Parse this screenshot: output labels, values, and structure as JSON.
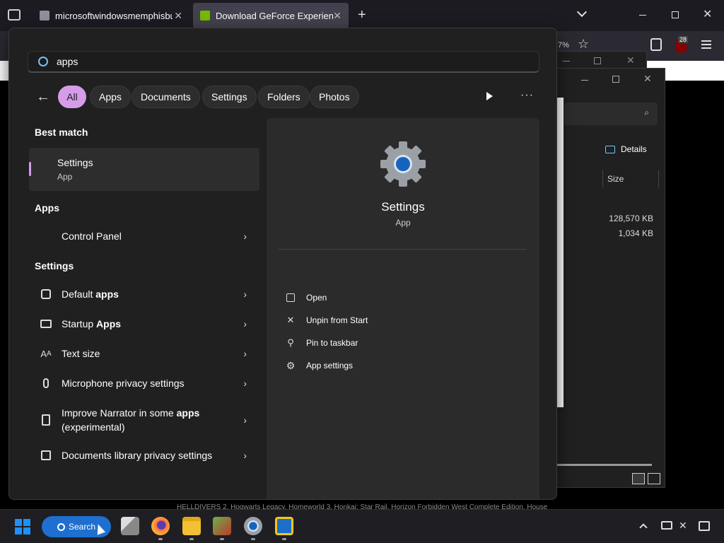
{
  "browser": {
    "tabs": [
      {
        "label": "microsoftwindowsmemphisbu",
        "close": "✕"
      },
      {
        "label": "Download GeForce Experience |",
        "close": "✕"
      }
    ],
    "new_tab": "+",
    "zoom_fragment": "7%",
    "extension_badge": "28"
  },
  "explorer": {
    "details_label": "Details",
    "size_header": "Size",
    "sizes": [
      "128,570 KB",
      "1,034 KB"
    ]
  },
  "background_text": "HELLDIVERS 2, Hogwarts Legacy, Homeworld 3, Honkai: Star Rail, Horizon Forbidden West Complete Edition, House",
  "search": {
    "query": "apps",
    "filters": [
      "All",
      "Apps",
      "Documents",
      "Settings",
      "Folders",
      "Photos"
    ],
    "more": "···",
    "best_match_heading": "Best match",
    "best_match": {
      "title": "Settings",
      "subtitle": "App"
    },
    "apps_heading": "Apps",
    "apps": [
      {
        "label": "Control Panel"
      }
    ],
    "settings_heading": "Settings",
    "settings_results": [
      {
        "pre": "Default ",
        "bold": "apps",
        "post": "",
        "line2": ""
      },
      {
        "pre": "Startup ",
        "bold": "Apps",
        "post": "",
        "line2": ""
      },
      {
        "pre": "Text size",
        "bold": "",
        "post": "",
        "line2": ""
      },
      {
        "pre": "Microphone privacy settings",
        "bold": "",
        "post": "",
        "line2": ""
      },
      {
        "pre": "Improve Narrator in some ",
        "bold": "apps",
        "post": "",
        "line2": "(experimental)"
      },
      {
        "pre": "Documents library privacy settings",
        "bold": "",
        "post": "",
        "line2": ""
      }
    ],
    "preview": {
      "title": "Settings",
      "subtitle": "App",
      "actions": [
        "Open",
        "Unpin from Start",
        "Pin to taskbar",
        "App settings"
      ]
    }
  },
  "taskbar": {
    "search_label": "Search"
  }
}
